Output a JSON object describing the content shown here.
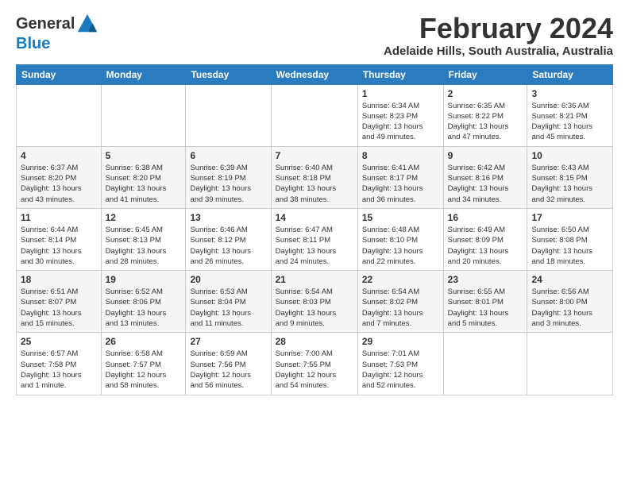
{
  "header": {
    "logo_general": "General",
    "logo_blue": "Blue",
    "month_title": "February 2024",
    "location": "Adelaide Hills, South Australia, Australia"
  },
  "weekdays": [
    "Sunday",
    "Monday",
    "Tuesday",
    "Wednesday",
    "Thursday",
    "Friday",
    "Saturday"
  ],
  "weeks": [
    [
      {
        "day": "",
        "info": ""
      },
      {
        "day": "",
        "info": ""
      },
      {
        "day": "",
        "info": ""
      },
      {
        "day": "",
        "info": ""
      },
      {
        "day": "1",
        "info": "Sunrise: 6:34 AM\nSunset: 8:23 PM\nDaylight: 13 hours\nand 49 minutes."
      },
      {
        "day": "2",
        "info": "Sunrise: 6:35 AM\nSunset: 8:22 PM\nDaylight: 13 hours\nand 47 minutes."
      },
      {
        "day": "3",
        "info": "Sunrise: 6:36 AM\nSunset: 8:21 PM\nDaylight: 13 hours\nand 45 minutes."
      }
    ],
    [
      {
        "day": "4",
        "info": "Sunrise: 6:37 AM\nSunset: 8:20 PM\nDaylight: 13 hours\nand 43 minutes."
      },
      {
        "day": "5",
        "info": "Sunrise: 6:38 AM\nSunset: 8:20 PM\nDaylight: 13 hours\nand 41 minutes."
      },
      {
        "day": "6",
        "info": "Sunrise: 6:39 AM\nSunset: 8:19 PM\nDaylight: 13 hours\nand 39 minutes."
      },
      {
        "day": "7",
        "info": "Sunrise: 6:40 AM\nSunset: 8:18 PM\nDaylight: 13 hours\nand 38 minutes."
      },
      {
        "day": "8",
        "info": "Sunrise: 6:41 AM\nSunset: 8:17 PM\nDaylight: 13 hours\nand 36 minutes."
      },
      {
        "day": "9",
        "info": "Sunrise: 6:42 AM\nSunset: 8:16 PM\nDaylight: 13 hours\nand 34 minutes."
      },
      {
        "day": "10",
        "info": "Sunrise: 6:43 AM\nSunset: 8:15 PM\nDaylight: 13 hours\nand 32 minutes."
      }
    ],
    [
      {
        "day": "11",
        "info": "Sunrise: 6:44 AM\nSunset: 8:14 PM\nDaylight: 13 hours\nand 30 minutes."
      },
      {
        "day": "12",
        "info": "Sunrise: 6:45 AM\nSunset: 8:13 PM\nDaylight: 13 hours\nand 28 minutes."
      },
      {
        "day": "13",
        "info": "Sunrise: 6:46 AM\nSunset: 8:12 PM\nDaylight: 13 hours\nand 26 minutes."
      },
      {
        "day": "14",
        "info": "Sunrise: 6:47 AM\nSunset: 8:11 PM\nDaylight: 13 hours\nand 24 minutes."
      },
      {
        "day": "15",
        "info": "Sunrise: 6:48 AM\nSunset: 8:10 PM\nDaylight: 13 hours\nand 22 minutes."
      },
      {
        "day": "16",
        "info": "Sunrise: 6:49 AM\nSunset: 8:09 PM\nDaylight: 13 hours\nand 20 minutes."
      },
      {
        "day": "17",
        "info": "Sunrise: 6:50 AM\nSunset: 8:08 PM\nDaylight: 13 hours\nand 18 minutes."
      }
    ],
    [
      {
        "day": "18",
        "info": "Sunrise: 6:51 AM\nSunset: 8:07 PM\nDaylight: 13 hours\nand 15 minutes."
      },
      {
        "day": "19",
        "info": "Sunrise: 6:52 AM\nSunset: 8:06 PM\nDaylight: 13 hours\nand 13 minutes."
      },
      {
        "day": "20",
        "info": "Sunrise: 6:53 AM\nSunset: 8:04 PM\nDaylight: 13 hours\nand 11 minutes."
      },
      {
        "day": "21",
        "info": "Sunrise: 6:54 AM\nSunset: 8:03 PM\nDaylight: 13 hours\nand 9 minutes."
      },
      {
        "day": "22",
        "info": "Sunrise: 6:54 AM\nSunset: 8:02 PM\nDaylight: 13 hours\nand 7 minutes."
      },
      {
        "day": "23",
        "info": "Sunrise: 6:55 AM\nSunset: 8:01 PM\nDaylight: 13 hours\nand 5 minutes."
      },
      {
        "day": "24",
        "info": "Sunrise: 6:56 AM\nSunset: 8:00 PM\nDaylight: 13 hours\nand 3 minutes."
      }
    ],
    [
      {
        "day": "25",
        "info": "Sunrise: 6:57 AM\nSunset: 7:58 PM\nDaylight: 13 hours\nand 1 minute."
      },
      {
        "day": "26",
        "info": "Sunrise: 6:58 AM\nSunset: 7:57 PM\nDaylight: 12 hours\nand 58 minutes."
      },
      {
        "day": "27",
        "info": "Sunrise: 6:59 AM\nSunset: 7:56 PM\nDaylight: 12 hours\nand 56 minutes."
      },
      {
        "day": "28",
        "info": "Sunrise: 7:00 AM\nSunset: 7:55 PM\nDaylight: 12 hours\nand 54 minutes."
      },
      {
        "day": "29",
        "info": "Sunrise: 7:01 AM\nSunset: 7:53 PM\nDaylight: 12 hours\nand 52 minutes."
      },
      {
        "day": "",
        "info": ""
      },
      {
        "day": "",
        "info": ""
      }
    ]
  ]
}
